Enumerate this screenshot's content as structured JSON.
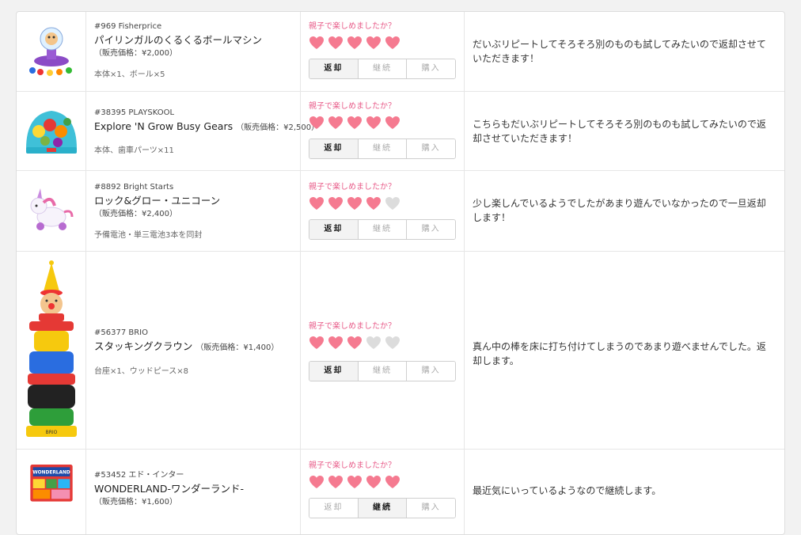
{
  "colors": {
    "heart_filled": "#f57a90",
    "heart_empty": "#dcdcdc",
    "question_text": "#e85d8a"
  },
  "question_label": "親子で楽しめましたか？",
  "buttons": [
    "返却",
    "継続",
    "購入"
  ],
  "items": [
    {
      "sku": "#969 Fisherprice",
      "name": "パイリンガルのくるくるボールマシン",
      "price": "（販売価格：¥2,000）",
      "contents": "本体×1、ボール×5",
      "rating": 5,
      "selected_button": "返却",
      "comment": "だいぶリピートしてそろそろ別のものも試してみたいので返却させていただきます！",
      "icon": "ball-machine-toy-icon"
    },
    {
      "sku": "#38395 PLAYSKOOL",
      "name": "Explore 'N Grow Busy Gears",
      "price": "（販売価格：¥2,500）",
      "contents": "本体、歯車パーツ×11",
      "rating": 5,
      "selected_button": "返却",
      "comment": "こちらもだいぶリピートしてそろそろ別のものも試してみたいので返却させていただきます！",
      "icon": "gears-toy-icon"
    },
    {
      "sku": "#8892 Bright Starts",
      "name": "ロック&グロー・ユニコーン",
      "price": "（販売価格：¥2,400）",
      "contents": "予備電池・単三電池3本を同封",
      "rating": 4,
      "selected_button": "返却",
      "comment": "少し楽しんでいるようでしたがあまり遊んでいなかったので一旦返却します！",
      "icon": "unicorn-toy-icon"
    },
    {
      "sku": "#56377 BRIO",
      "name": "スタッキングクラウン",
      "price": "（販売価格：¥1,400）",
      "contents": "台座×1、ウッドピース×8",
      "rating": 3,
      "selected_button": "返却",
      "comment": "真ん中の棒を床に打ち付けてしまうのであまり遊べませんでした。返却します。",
      "icon": "stacking-clown-toy-icon",
      "thumb_text": "BRIO"
    },
    {
      "sku": "#53452 エド・インター",
      "name": "WONDERLAND-ワンダーランド-",
      "price": "（販売価格：¥1,600）",
      "contents": "",
      "rating": 5,
      "selected_button": "継続",
      "comment": "最近気にいっているようなので継続します。",
      "icon": "wonderland-box-toy-icon",
      "thumb_text": "WONDERLAND"
    }
  ]
}
